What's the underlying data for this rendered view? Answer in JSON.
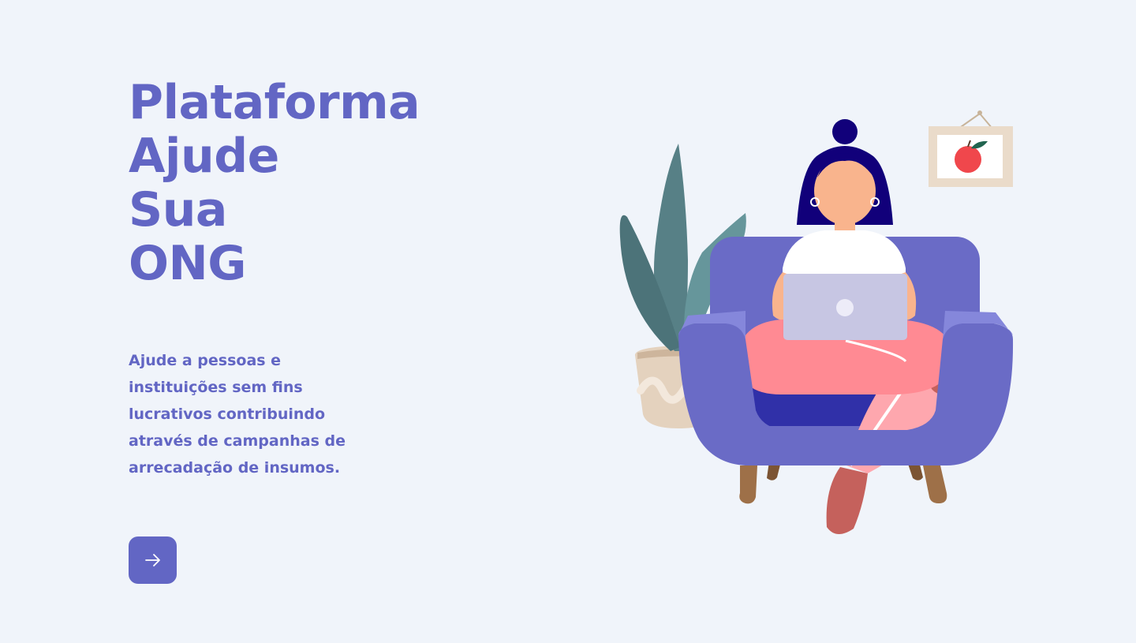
{
  "hero": {
    "title_lines": [
      "Plataforma",
      "Ajude",
      "Sua",
      "ONG"
    ],
    "description": "Ajude a pessoas e instituições sem fins lucrativos contribuindo através de campanhas de arrecadação de insumos."
  },
  "cta": {
    "icon": "arrow-right-icon"
  },
  "illustration": {
    "subject": "woman-with-laptop-on-armchair"
  },
  "colors": {
    "background": "#F0F4FA",
    "accent": "#6266C4",
    "armchair": "#6A6BC6",
    "hair": "#11007A",
    "pants": "#FF8A93",
    "plant": "#578086"
  }
}
